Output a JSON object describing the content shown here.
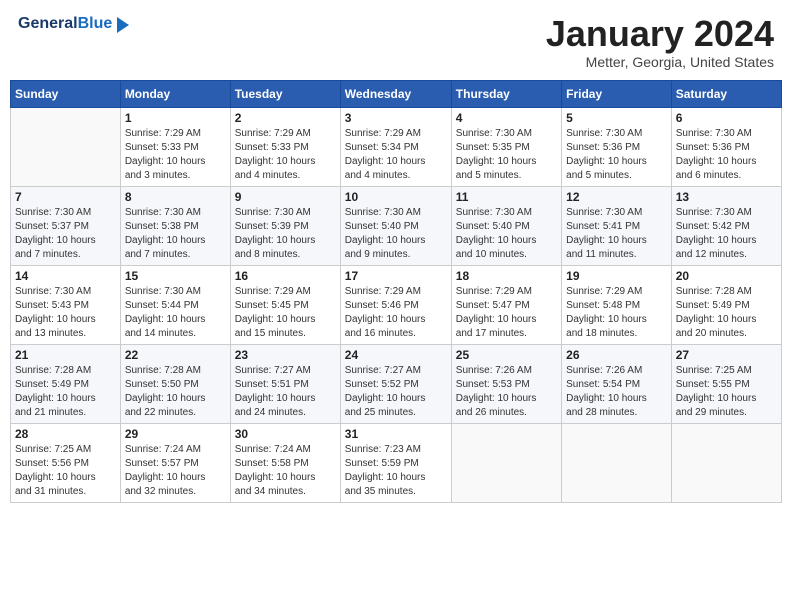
{
  "header": {
    "logo_general": "General",
    "logo_blue": "Blue",
    "title": "January 2024",
    "location": "Metter, Georgia, United States"
  },
  "columns": [
    "Sunday",
    "Monday",
    "Tuesday",
    "Wednesday",
    "Thursday",
    "Friday",
    "Saturday"
  ],
  "weeks": [
    [
      {
        "num": "",
        "detail": ""
      },
      {
        "num": "1",
        "detail": "Sunrise: 7:29 AM\nSunset: 5:33 PM\nDaylight: 10 hours\nand 3 minutes."
      },
      {
        "num": "2",
        "detail": "Sunrise: 7:29 AM\nSunset: 5:33 PM\nDaylight: 10 hours\nand 4 minutes."
      },
      {
        "num": "3",
        "detail": "Sunrise: 7:29 AM\nSunset: 5:34 PM\nDaylight: 10 hours\nand 4 minutes."
      },
      {
        "num": "4",
        "detail": "Sunrise: 7:30 AM\nSunset: 5:35 PM\nDaylight: 10 hours\nand 5 minutes."
      },
      {
        "num": "5",
        "detail": "Sunrise: 7:30 AM\nSunset: 5:36 PM\nDaylight: 10 hours\nand 5 minutes."
      },
      {
        "num": "6",
        "detail": "Sunrise: 7:30 AM\nSunset: 5:36 PM\nDaylight: 10 hours\nand 6 minutes."
      }
    ],
    [
      {
        "num": "7",
        "detail": "Sunrise: 7:30 AM\nSunset: 5:37 PM\nDaylight: 10 hours\nand 7 minutes."
      },
      {
        "num": "8",
        "detail": "Sunrise: 7:30 AM\nSunset: 5:38 PM\nDaylight: 10 hours\nand 7 minutes."
      },
      {
        "num": "9",
        "detail": "Sunrise: 7:30 AM\nSunset: 5:39 PM\nDaylight: 10 hours\nand 8 minutes."
      },
      {
        "num": "10",
        "detail": "Sunrise: 7:30 AM\nSunset: 5:40 PM\nDaylight: 10 hours\nand 9 minutes."
      },
      {
        "num": "11",
        "detail": "Sunrise: 7:30 AM\nSunset: 5:40 PM\nDaylight: 10 hours\nand 10 minutes."
      },
      {
        "num": "12",
        "detail": "Sunrise: 7:30 AM\nSunset: 5:41 PM\nDaylight: 10 hours\nand 11 minutes."
      },
      {
        "num": "13",
        "detail": "Sunrise: 7:30 AM\nSunset: 5:42 PM\nDaylight: 10 hours\nand 12 minutes."
      }
    ],
    [
      {
        "num": "14",
        "detail": "Sunrise: 7:30 AM\nSunset: 5:43 PM\nDaylight: 10 hours\nand 13 minutes."
      },
      {
        "num": "15",
        "detail": "Sunrise: 7:30 AM\nSunset: 5:44 PM\nDaylight: 10 hours\nand 14 minutes."
      },
      {
        "num": "16",
        "detail": "Sunrise: 7:29 AM\nSunset: 5:45 PM\nDaylight: 10 hours\nand 15 minutes."
      },
      {
        "num": "17",
        "detail": "Sunrise: 7:29 AM\nSunset: 5:46 PM\nDaylight: 10 hours\nand 16 minutes."
      },
      {
        "num": "18",
        "detail": "Sunrise: 7:29 AM\nSunset: 5:47 PM\nDaylight: 10 hours\nand 17 minutes."
      },
      {
        "num": "19",
        "detail": "Sunrise: 7:29 AM\nSunset: 5:48 PM\nDaylight: 10 hours\nand 18 minutes."
      },
      {
        "num": "20",
        "detail": "Sunrise: 7:28 AM\nSunset: 5:49 PM\nDaylight: 10 hours\nand 20 minutes."
      }
    ],
    [
      {
        "num": "21",
        "detail": "Sunrise: 7:28 AM\nSunset: 5:49 PM\nDaylight: 10 hours\nand 21 minutes."
      },
      {
        "num": "22",
        "detail": "Sunrise: 7:28 AM\nSunset: 5:50 PM\nDaylight: 10 hours\nand 22 minutes."
      },
      {
        "num": "23",
        "detail": "Sunrise: 7:27 AM\nSunset: 5:51 PM\nDaylight: 10 hours\nand 24 minutes."
      },
      {
        "num": "24",
        "detail": "Sunrise: 7:27 AM\nSunset: 5:52 PM\nDaylight: 10 hours\nand 25 minutes."
      },
      {
        "num": "25",
        "detail": "Sunrise: 7:26 AM\nSunset: 5:53 PM\nDaylight: 10 hours\nand 26 minutes."
      },
      {
        "num": "26",
        "detail": "Sunrise: 7:26 AM\nSunset: 5:54 PM\nDaylight: 10 hours\nand 28 minutes."
      },
      {
        "num": "27",
        "detail": "Sunrise: 7:25 AM\nSunset: 5:55 PM\nDaylight: 10 hours\nand 29 minutes."
      }
    ],
    [
      {
        "num": "28",
        "detail": "Sunrise: 7:25 AM\nSunset: 5:56 PM\nDaylight: 10 hours\nand 31 minutes."
      },
      {
        "num": "29",
        "detail": "Sunrise: 7:24 AM\nSunset: 5:57 PM\nDaylight: 10 hours\nand 32 minutes."
      },
      {
        "num": "30",
        "detail": "Sunrise: 7:24 AM\nSunset: 5:58 PM\nDaylight: 10 hours\nand 34 minutes."
      },
      {
        "num": "31",
        "detail": "Sunrise: 7:23 AM\nSunset: 5:59 PM\nDaylight: 10 hours\nand 35 minutes."
      },
      {
        "num": "",
        "detail": ""
      },
      {
        "num": "",
        "detail": ""
      },
      {
        "num": "",
        "detail": ""
      }
    ]
  ]
}
